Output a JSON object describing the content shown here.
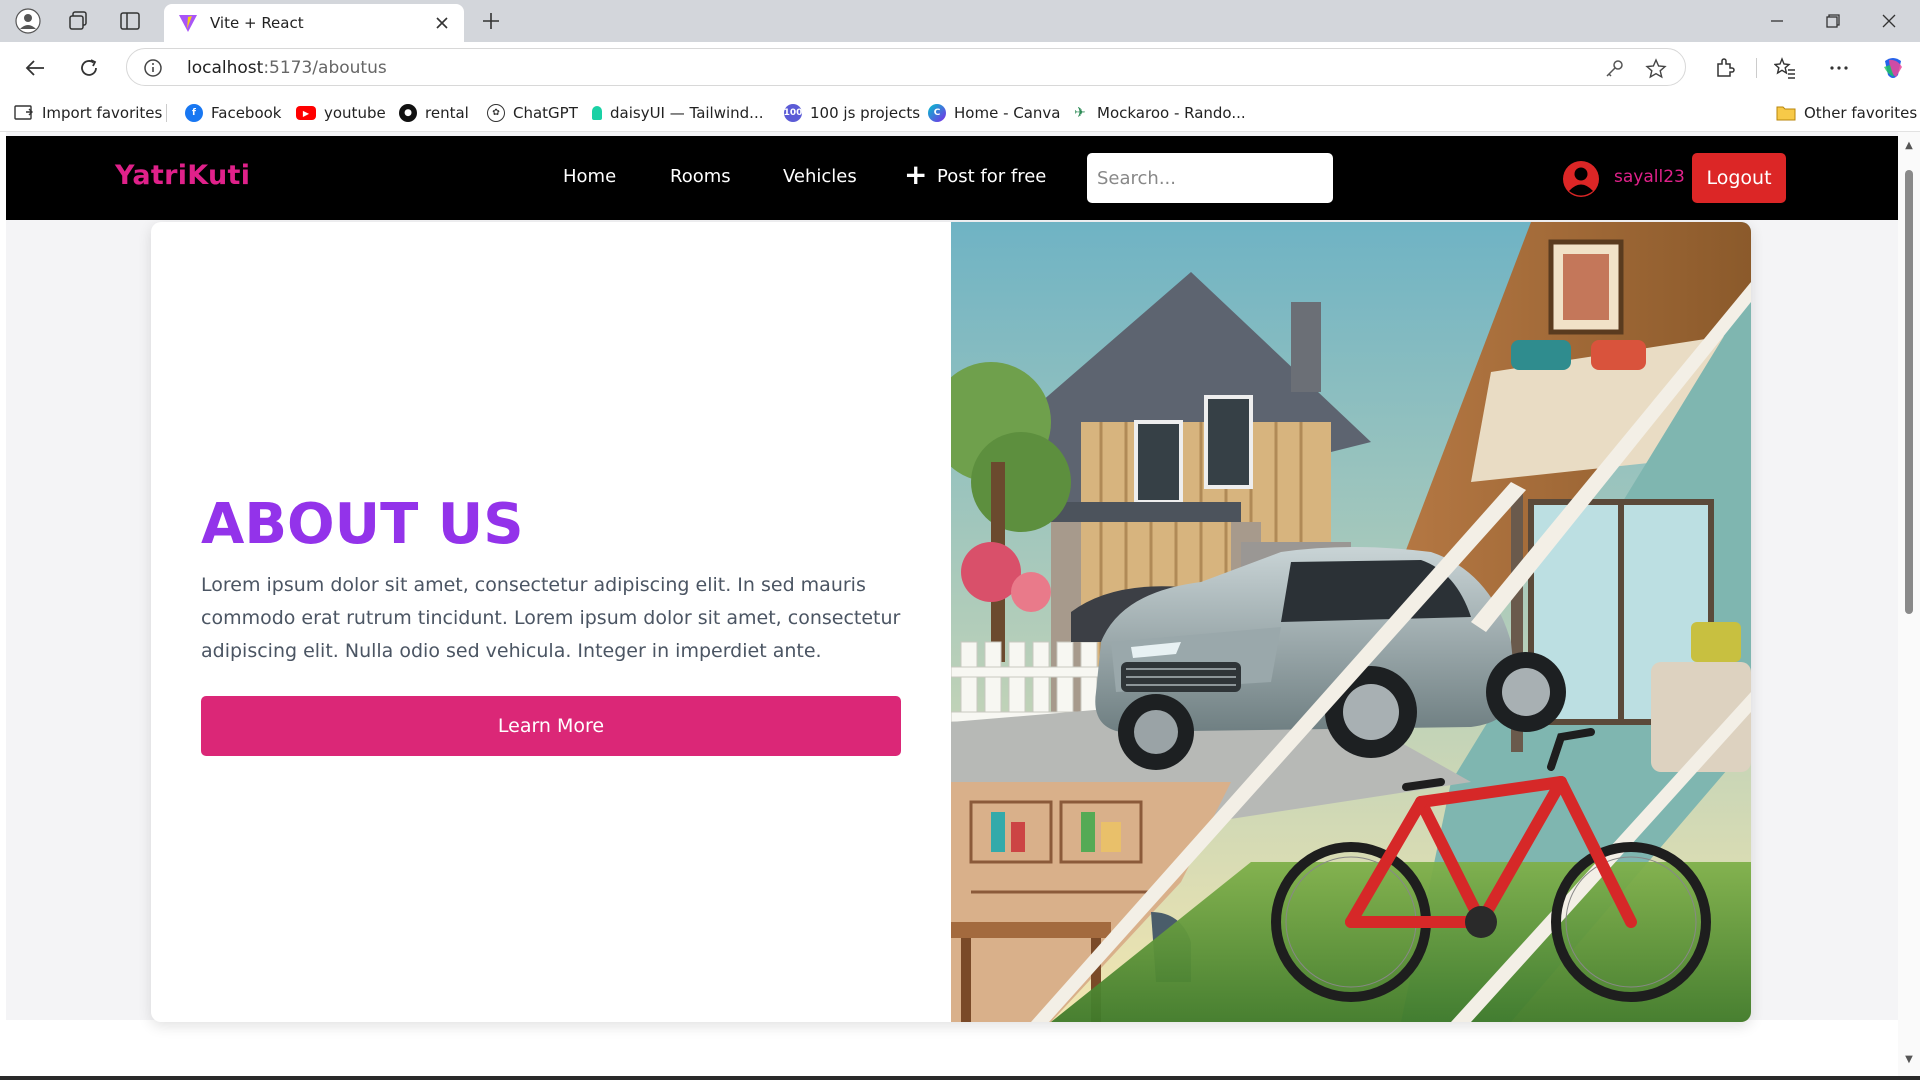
{
  "browser": {
    "tab_title": "Vite + React",
    "url_host": "localhost",
    "url_path": ":5173/aboutus",
    "bookmarks": [
      {
        "label": "Import favorites",
        "icon": "import-icon"
      },
      {
        "label": "Facebook",
        "icon": "facebook-icon",
        "color": "#1877f2"
      },
      {
        "label": "youtube",
        "icon": "youtube-icon",
        "color": "#ff0000"
      },
      {
        "label": "rental",
        "icon": "github-icon",
        "color": "#111111"
      },
      {
        "label": "ChatGPT",
        "icon": "chatgpt-icon",
        "color": "#333333"
      },
      {
        "label": "daisyUI — Tailwind...",
        "icon": "daisyui-icon",
        "color": "#1ad1a5"
      },
      {
        "label": "100 js projects",
        "icon": "100-icon",
        "badge": "100",
        "color": "#5b5bd6"
      },
      {
        "label": "Home - Canva",
        "icon": "canva-icon",
        "color": "#00c4cc"
      },
      {
        "label": "Mockaroo - Rando...",
        "icon": "mockaroo-icon",
        "color": "#2e8b57"
      }
    ],
    "other_favorites": "Other favorites"
  },
  "site": {
    "brand": "YatriKuti",
    "nav": [
      "Home",
      "Rooms",
      "Vehicles",
      "Post for free"
    ],
    "search_placeholder": "Search...",
    "username": "sayall23",
    "logout": "Logout",
    "brand_color": "#e0218a"
  },
  "about": {
    "title": "ABOUT US",
    "text": "Lorem ipsum dolor sit amet, consectetur adipiscing elit. In sed mauris commodo erat rutrum tincidunt. Lorem ipsum dolor sit amet, consectetur adipiscing elit. Nulla odio sed vehicula. Integer in imperdiet ante.",
    "button": "Learn More",
    "title_color": "#9333ea",
    "button_color": "#db2777"
  }
}
